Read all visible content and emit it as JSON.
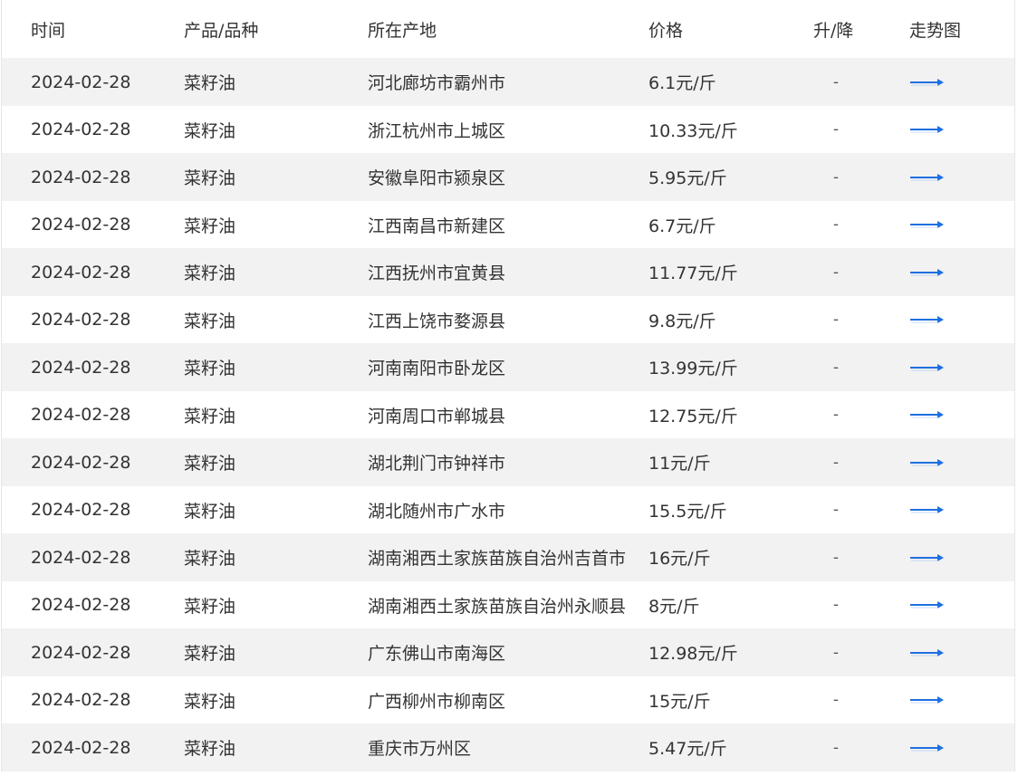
{
  "table": {
    "columns": [
      "时间",
      "产品/品种",
      "所在产地",
      "价格",
      "升/降",
      "走势图"
    ],
    "trend_icon": "arrow-right-icon",
    "accent_color": "#1e6fe0",
    "rows": [
      {
        "date": "2024-02-28",
        "product": "菜籽油",
        "location": "河北廊坊市霸州市",
        "price": "6.1元/斤",
        "change": "-"
      },
      {
        "date": "2024-02-28",
        "product": "菜籽油",
        "location": "浙江杭州市上城区",
        "price": "10.33元/斤",
        "change": "-"
      },
      {
        "date": "2024-02-28",
        "product": "菜籽油",
        "location": "安徽阜阳市颍泉区",
        "price": "5.95元/斤",
        "change": "-"
      },
      {
        "date": "2024-02-28",
        "product": "菜籽油",
        "location": "江西南昌市新建区",
        "price": "6.7元/斤",
        "change": "-"
      },
      {
        "date": "2024-02-28",
        "product": "菜籽油",
        "location": "江西抚州市宜黄县",
        "price": "11.77元/斤",
        "change": "-"
      },
      {
        "date": "2024-02-28",
        "product": "菜籽油",
        "location": "江西上饶市婺源县",
        "price": "9.8元/斤",
        "change": "-"
      },
      {
        "date": "2024-02-28",
        "product": "菜籽油",
        "location": "河南南阳市卧龙区",
        "price": "13.99元/斤",
        "change": "-"
      },
      {
        "date": "2024-02-28",
        "product": "菜籽油",
        "location": "河南周口市郸城县",
        "price": "12.75元/斤",
        "change": "-"
      },
      {
        "date": "2024-02-28",
        "product": "菜籽油",
        "location": "湖北荆门市钟祥市",
        "price": "11元/斤",
        "change": "-"
      },
      {
        "date": "2024-02-28",
        "product": "菜籽油",
        "location": "湖北随州市广水市",
        "price": "15.5元/斤",
        "change": "-"
      },
      {
        "date": "2024-02-28",
        "product": "菜籽油",
        "location": "湖南湘西土家族苗族自治州吉首市",
        "price": "16元/斤",
        "change": "-"
      },
      {
        "date": "2024-02-28",
        "product": "菜籽油",
        "location": "湖南湘西土家族苗族自治州永顺县",
        "price": "8元/斤",
        "change": "-"
      },
      {
        "date": "2024-02-28",
        "product": "菜籽油",
        "location": "广东佛山市南海区",
        "price": "12.98元/斤",
        "change": "-"
      },
      {
        "date": "2024-02-28",
        "product": "菜籽油",
        "location": "广西柳州市柳南区",
        "price": "15元/斤",
        "change": "-"
      },
      {
        "date": "2024-02-28",
        "product": "菜籽油",
        "location": "重庆市万州区",
        "price": "5.47元/斤",
        "change": "-"
      }
    ]
  }
}
